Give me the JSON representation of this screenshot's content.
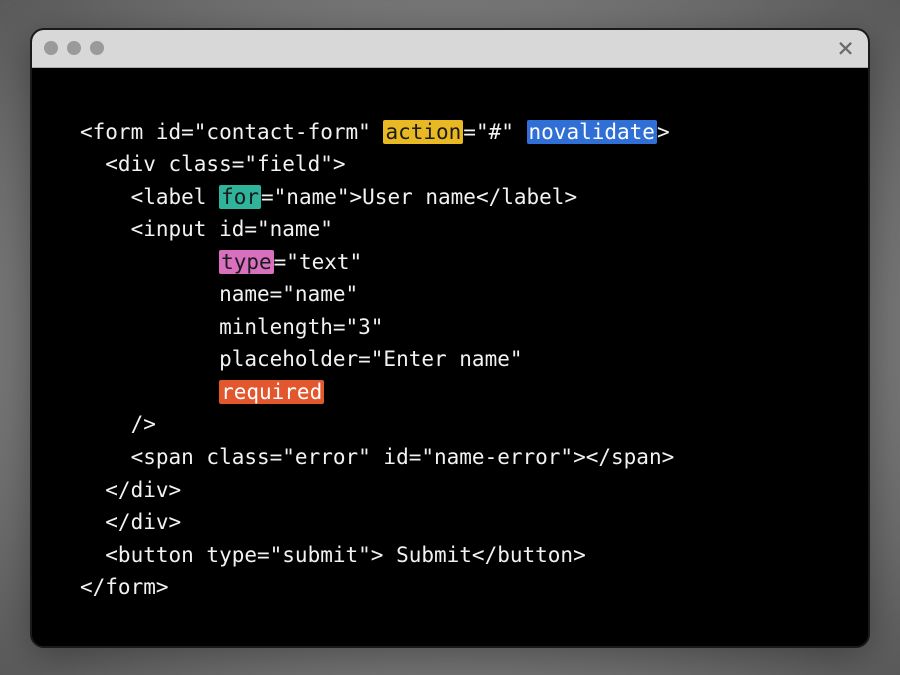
{
  "code": {
    "line1": {
      "pre": "<form id=\"contact-form\" ",
      "action": "action",
      "mid1": "=\"#\" ",
      "novalidate": "novalidate",
      "post": ">"
    },
    "line2": "  <div class=\"field\">",
    "line3": {
      "pre": "    <label ",
      "for": "for",
      "post": "=\"name\">User name</label>"
    },
    "line4": "    <input id=\"name\"",
    "line5": {
      "pre": "           ",
      "type": "type",
      "post": "=\"text\""
    },
    "line6": "           name=\"name\"",
    "line7": "           minlength=\"3\"",
    "line8": "           placeholder=\"Enter name\"",
    "line9": {
      "pre": "           ",
      "required": "required"
    },
    "line10": "    />",
    "line11": "    <span class=\"error\" id=\"name-error\"></span>",
    "line12": "  </div>",
    "line13": "  </div>",
    "line14": "  <button type=\"submit\"> Submit</button>",
    "line15": "</form>"
  },
  "icons": {
    "close": "×"
  }
}
